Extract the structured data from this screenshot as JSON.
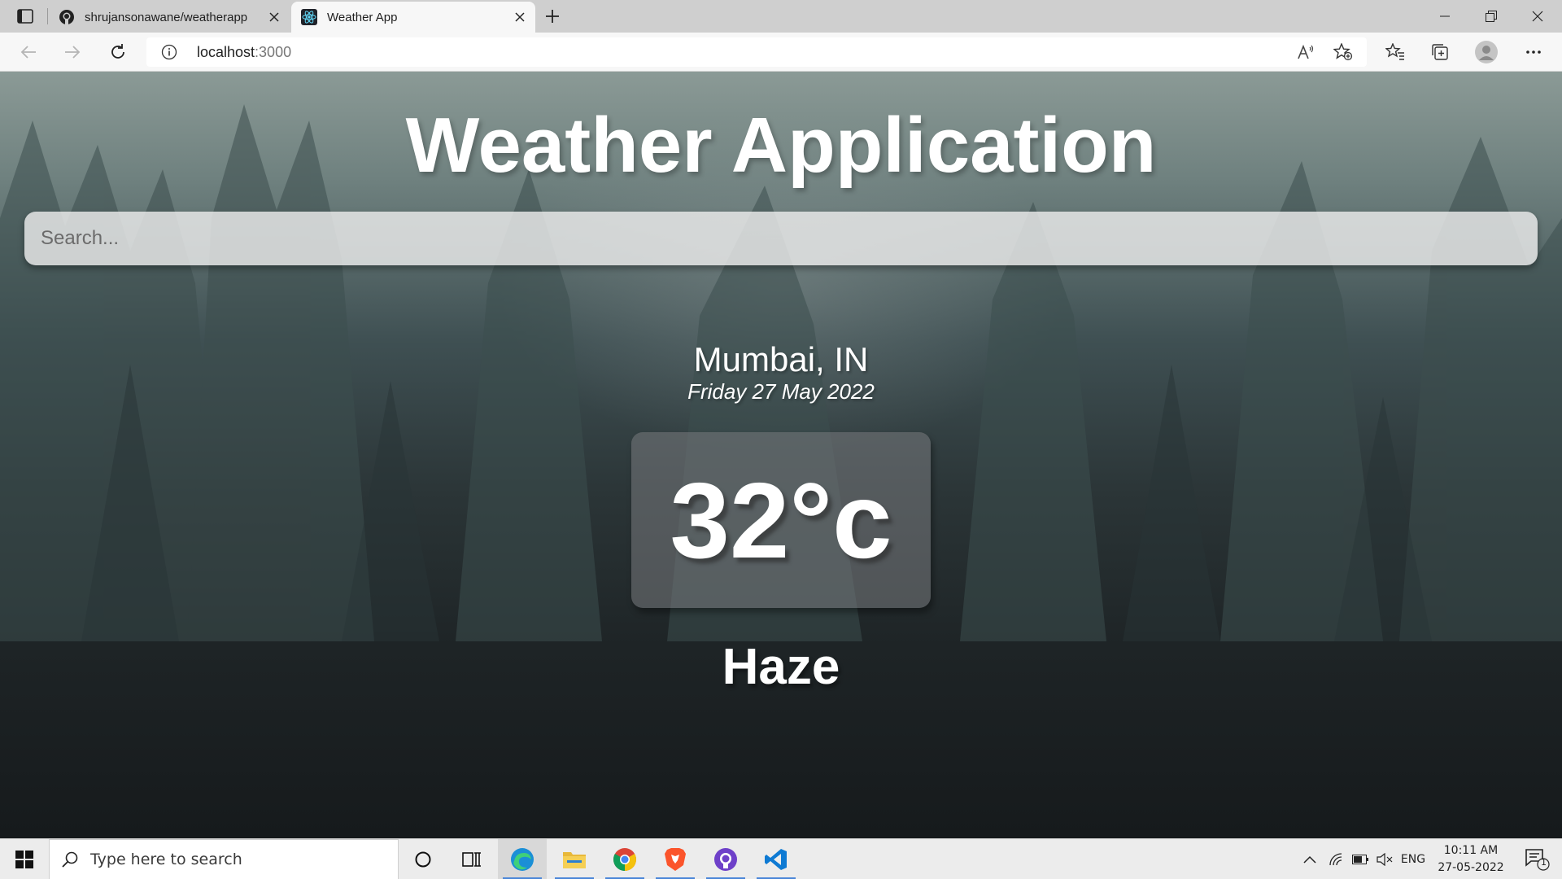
{
  "browser": {
    "tabs": [
      {
        "title": "shrujansonawane/weatherapp",
        "icon": "github-icon",
        "active": false
      },
      {
        "title": "Weather App",
        "icon": "react-icon",
        "active": true
      }
    ],
    "address": {
      "host": "localhost",
      "port": ":3000"
    }
  },
  "page": {
    "title": "Weather Application",
    "search_placeholder": "Search...",
    "location": "Mumbai, IN",
    "date": "Friday 27 May 2022",
    "temperature": "32°c",
    "condition": "Haze"
  },
  "taskbar": {
    "search_placeholder": "Type here to search",
    "language": "ENG",
    "time": "10:11 AM",
    "date": "27-05-2022",
    "notification_count": "1",
    "pinned": [
      "task-view-icon",
      "cortana-icon",
      "edge-icon",
      "file-explorer-icon",
      "chrome-icon",
      "brave-icon",
      "github-desktop-icon",
      "vscode-icon"
    ]
  },
  "colors": {
    "page_text": "#ffffff",
    "taskbar_accent": "#4a86d8"
  }
}
